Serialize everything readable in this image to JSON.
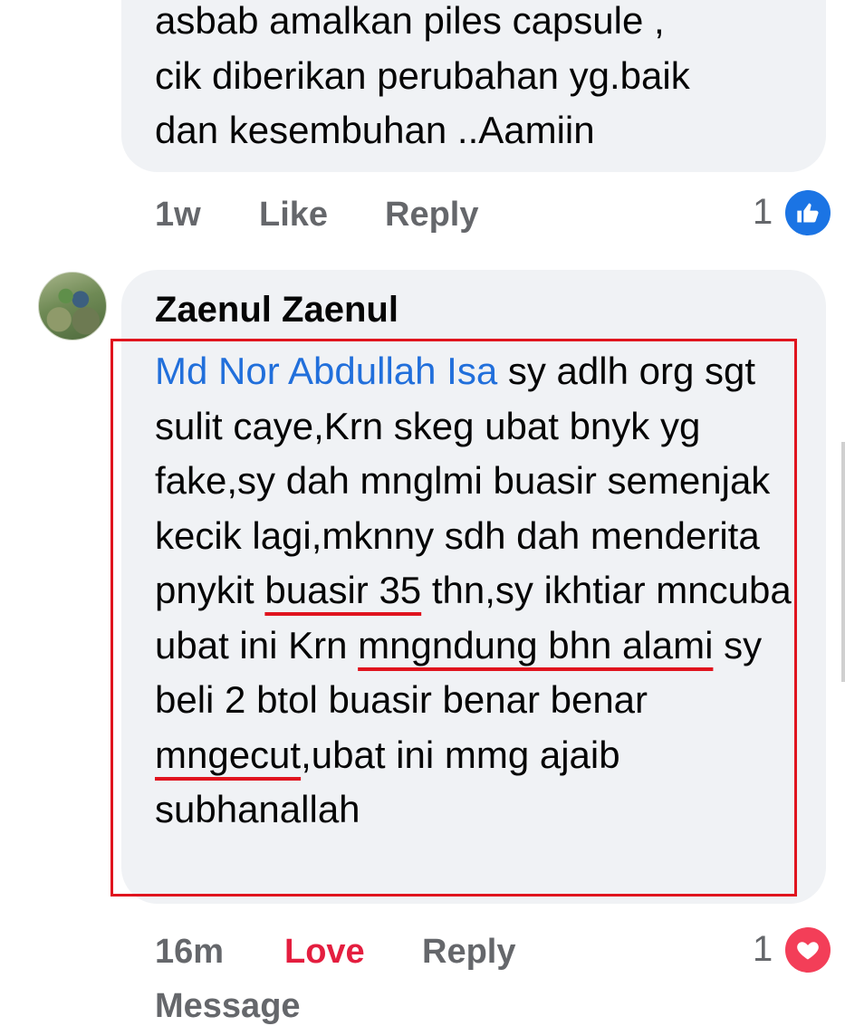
{
  "comment1": {
    "lines": [
      "asbab amalkan piles capsule ,",
      "cik diberikan perubahan yg.baik",
      "dan kesembuhan ..Aamiin"
    ],
    "time": "1w",
    "like_label": "Like",
    "reply_label": "Reply",
    "reaction_count": "1",
    "reaction_icon": "like-icon"
  },
  "comment2": {
    "author": "Zaenul Zaenul",
    "mention": "Md Nor Abdullah Isa",
    "segments": {
      "s1": " sy adlh org sgt sulit caye,Krn skeg ubat bnyk yg fake,sy dah mnglmi buasir semenjak kecik lagi,mknny sdh dah menderita pnykit ",
      "u1": "buasir 35",
      "s2": " thn,sy ikhtiar mncuba ubat ini Krn ",
      "u2": "mngndung bhn alami",
      "s3": " sy beli 2 btol buasir benar benar ",
      "u3": "mngecut",
      "s4": ",ubat ini mmg ajaib subhanallah"
    },
    "time": "16m",
    "love_label": "Love",
    "reply_label": "Reply",
    "message_label": "Message",
    "reaction_count": "1",
    "reaction_icon": "love-icon"
  },
  "colors": {
    "mention": "#216fdb",
    "annotation": "#e0141e",
    "love": "#e41e3f",
    "like": "#1b74e4",
    "meta": "#65676b",
    "bubble": "#f0f2f5"
  }
}
